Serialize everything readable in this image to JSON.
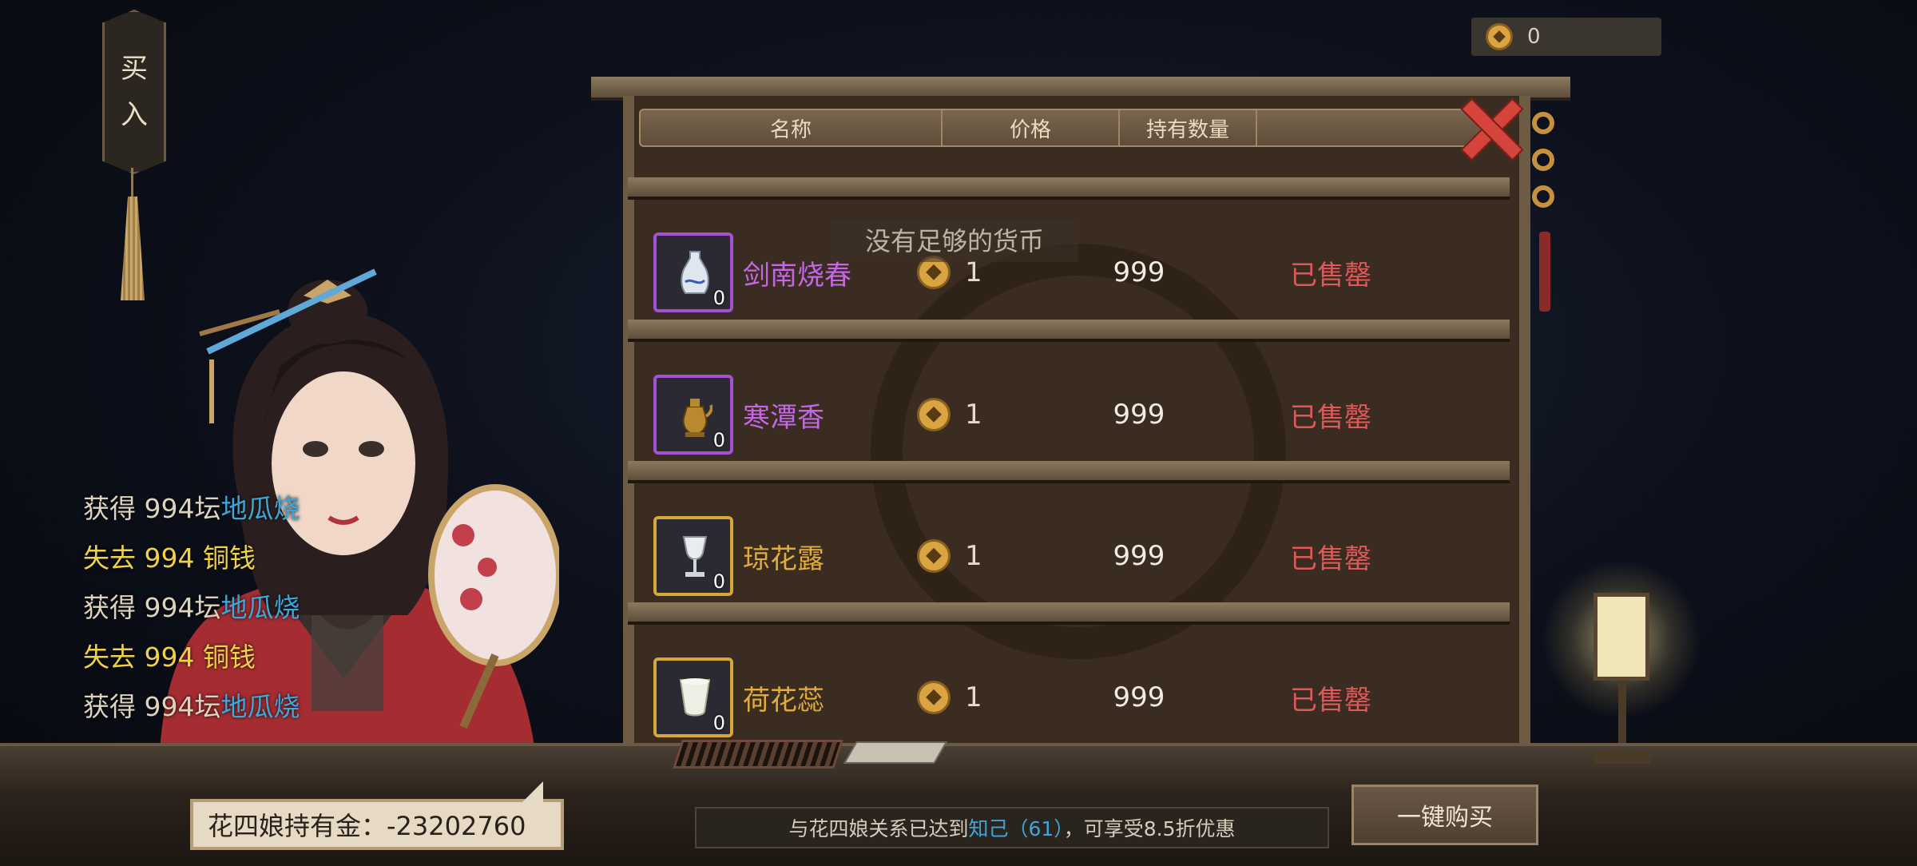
{
  "buy_tag": {
    "line1": "买",
    "line2": "入"
  },
  "currency": {
    "amount": "0",
    "icon": "coin-icon"
  },
  "table_header": {
    "name": "名称",
    "price": "价格",
    "held": "持有数量"
  },
  "toast": "没有足够的货币",
  "items": [
    {
      "name": "剑南烧春",
      "rarity": "purple",
      "icon": "liquor-vase-icon",
      "owned": "0",
      "price": "1",
      "held": "999",
      "status": "已售罄"
    },
    {
      "name": "寒潭香",
      "rarity": "purple",
      "icon": "teapot-icon",
      "owned": "0",
      "price": "1",
      "held": "999",
      "status": "已售罄"
    },
    {
      "name": "琼花露",
      "rarity": "gold",
      "icon": "wine-goblet-icon",
      "owned": "0",
      "price": "1",
      "held": "999",
      "status": "已售罄"
    },
    {
      "name": "荷花蕊",
      "rarity": "gold",
      "icon": "wine-cup-icon",
      "owned": "0",
      "price": "1",
      "held": "999",
      "status": "已售罄"
    }
  ],
  "log": [
    {
      "prefix": "获得 994坛",
      "highlight": "地瓜烧",
      "type": "gain"
    },
    {
      "prefix": "失去 994 铜钱",
      "highlight": "",
      "type": "loss"
    },
    {
      "prefix": "获得 994坛",
      "highlight": "地瓜烧",
      "type": "gain"
    },
    {
      "prefix": "失去 994 铜钱",
      "highlight": "",
      "type": "loss"
    },
    {
      "prefix": "获得 994坛",
      "highlight": "地瓜烧",
      "type": "gain"
    }
  ],
  "merchant_gold": "花四娘持有金：-23202760",
  "relation": {
    "before": "与花四娘关系已达到",
    "level": "知己（61）",
    "after": "，可享受8.5折优惠"
  },
  "buy_all_label": "一键购买",
  "colors": {
    "purple": "#c466e6",
    "gold": "#e0ac3c",
    "sold_out": "#e0595a",
    "highlight": "#3fa6d8"
  }
}
